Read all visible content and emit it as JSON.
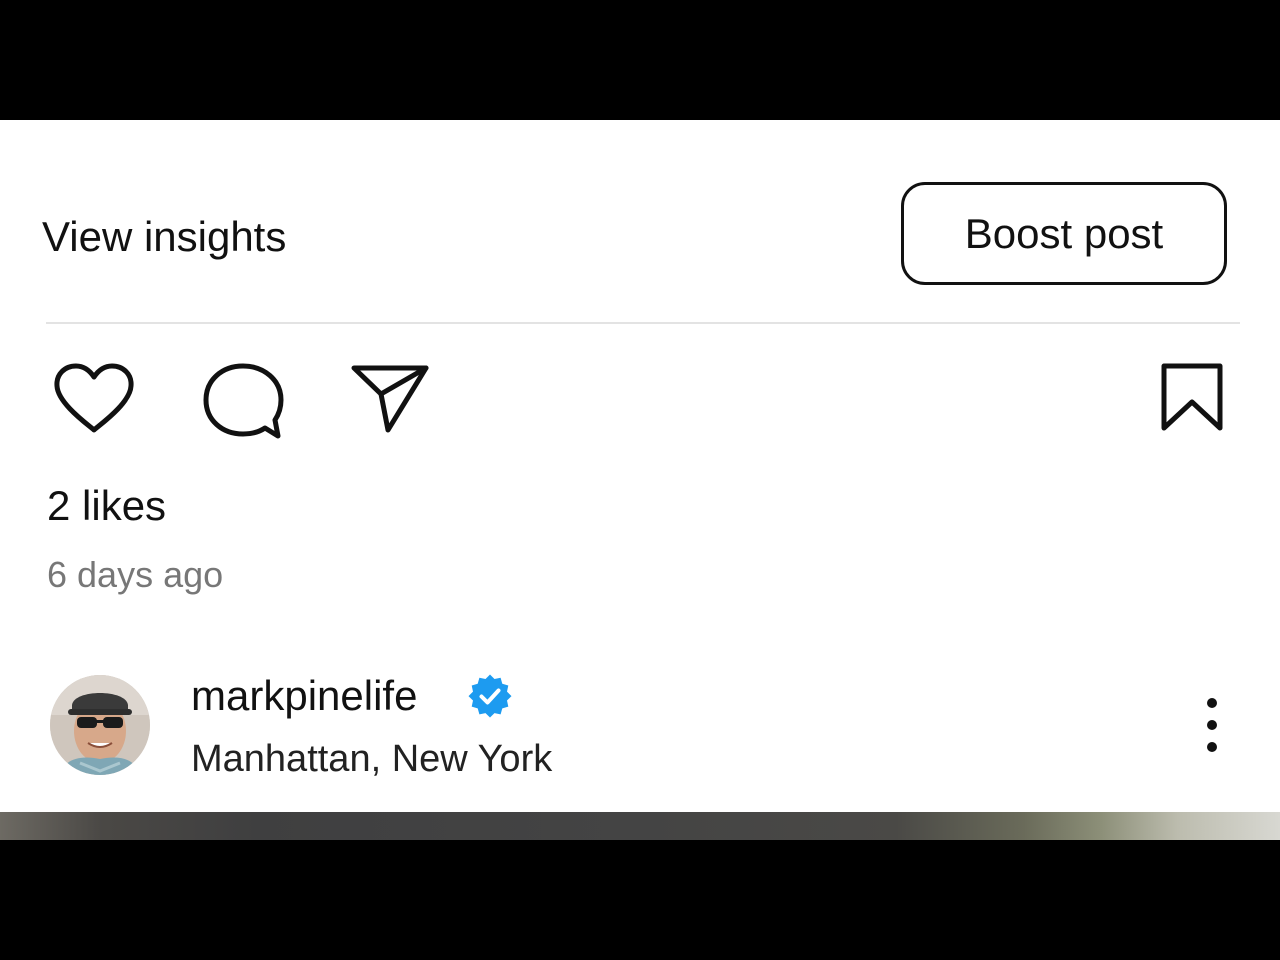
{
  "header": {
    "view_insights_label": "View insights",
    "boost_post_label": "Boost post"
  },
  "actions": {
    "like_icon": "heart-icon",
    "comment_icon": "comment-bubble-icon",
    "share_icon": "paper-plane-icon",
    "save_icon": "bookmark-icon"
  },
  "post": {
    "likes_text": "2 likes",
    "timestamp": "6 days ago"
  },
  "author": {
    "username": "markpinelife",
    "verified": true,
    "verified_color": "#1d9bf0",
    "location": "Manhattan, New York"
  },
  "colors": {
    "text": "#111111",
    "muted": "#777777",
    "divider": "#e3e3e3"
  }
}
